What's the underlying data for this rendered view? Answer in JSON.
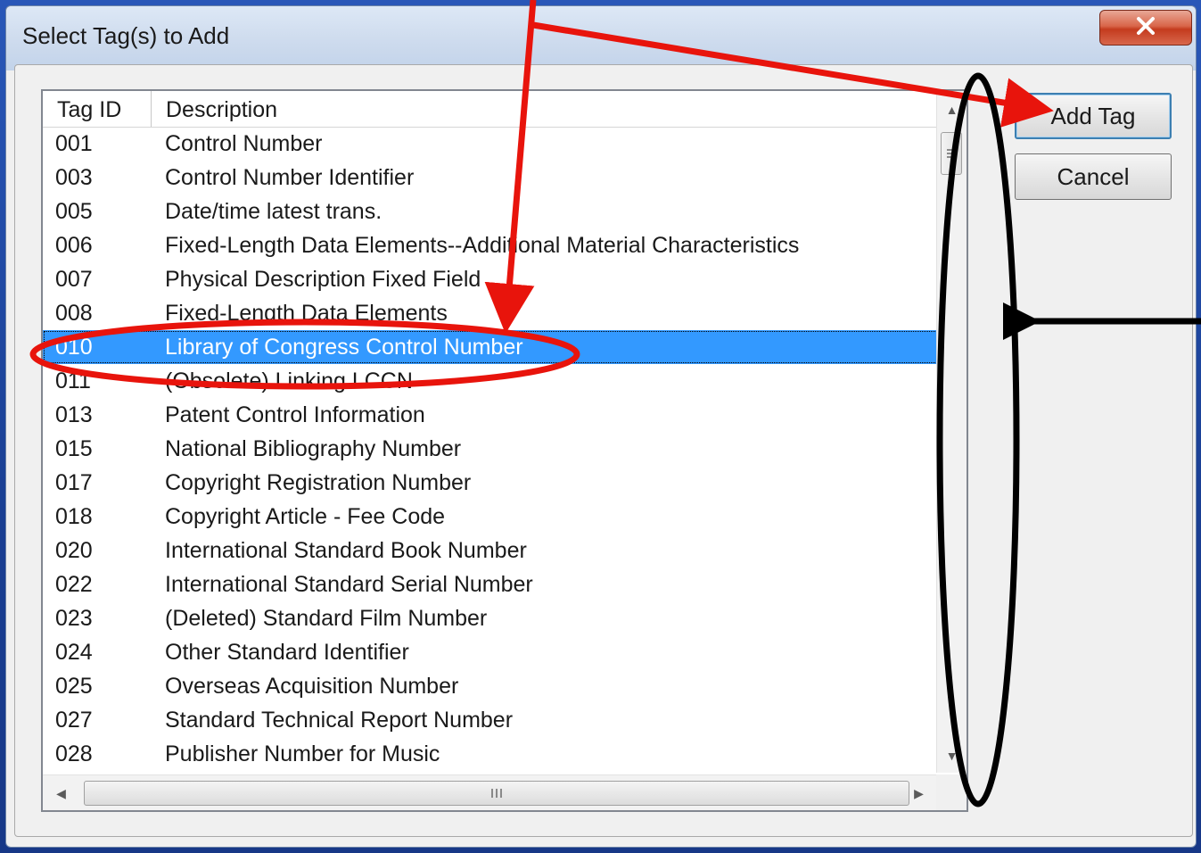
{
  "dialog": {
    "title": "Select Tag(s) to Add"
  },
  "list": {
    "columns": {
      "tag_id": "Tag ID",
      "description": "Description"
    },
    "rows": [
      {
        "id": "001",
        "description": "Control Number"
      },
      {
        "id": "003",
        "description": "Control Number Identifier"
      },
      {
        "id": "005",
        "description": "Date/time latest trans."
      },
      {
        "id": "006",
        "description": "Fixed-Length Data Elements--Additional Material Characteristics"
      },
      {
        "id": "007",
        "description": "Physical Description Fixed Field"
      },
      {
        "id": "008",
        "description": "Fixed-Length Data Elements"
      },
      {
        "id": "010",
        "description": "Library of Congress Control Number",
        "selected": true
      },
      {
        "id": "011",
        "description": "(Obsolete) Linking LCCN"
      },
      {
        "id": "013",
        "description": "Patent Control Information"
      },
      {
        "id": "015",
        "description": "National Bibliography Number"
      },
      {
        "id": "017",
        "description": "Copyright Registration Number"
      },
      {
        "id": "018",
        "description": "Copyright Article - Fee Code"
      },
      {
        "id": "020",
        "description": "International Standard Book Number"
      },
      {
        "id": "022",
        "description": "International Standard Serial Number"
      },
      {
        "id": "023",
        "description": "(Deleted) Standard Film Number"
      },
      {
        "id": "024",
        "description": "Other Standard Identifier"
      },
      {
        "id": "025",
        "description": "Overseas Acquisition Number"
      },
      {
        "id": "027",
        "description": "Standard Technical Report Number"
      },
      {
        "id": "028",
        "description": "Publisher Number for Music"
      }
    ]
  },
  "buttons": {
    "add_tag": "Add Tag",
    "cancel": "Cancel"
  },
  "icons": {
    "close": "close-icon",
    "scroll_up": "arrow-up-icon",
    "scroll_down": "arrow-down-icon",
    "scroll_left": "arrow-left-icon",
    "scroll_right": "arrow-right-icon"
  },
  "colors": {
    "selection": "#3399ff",
    "annotation_red": "#e8140c",
    "annotation_black": "#000000",
    "close_button": "#c43b1e"
  }
}
